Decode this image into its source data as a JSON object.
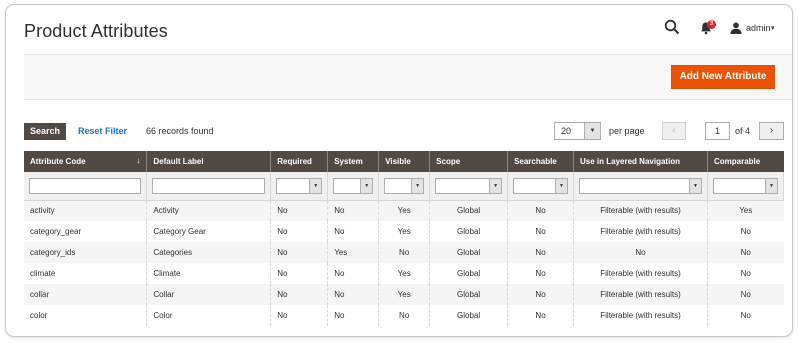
{
  "page": {
    "title": "Product Attributes"
  },
  "header": {
    "notification_count": "3",
    "user_name": "admin",
    "caret": "▾"
  },
  "actions": {
    "add_new_label": "Add New Attribute"
  },
  "toolbar": {
    "search_label": "Search",
    "reset_filter_label": "Reset Filter",
    "records_found": "66 records found",
    "per_page_value": "20",
    "per_page_label": "per page",
    "current_page": "1",
    "page_of": "of 4",
    "prev_symbol": "‹",
    "next_symbol": "›"
  },
  "table": {
    "columns": [
      "Attribute Code",
      "Default Label",
      "Required",
      "System",
      "Visible",
      "Scope",
      "Searchable",
      "Use in Layered Navigation",
      "Comparable"
    ],
    "sort_indicator": "↓",
    "rows": [
      [
        "activity",
        "Activity",
        "No",
        "No",
        "Yes",
        "Global",
        "No",
        "Filterable (with results)",
        "Yes"
      ],
      [
        "category_gear",
        "Category Gear",
        "No",
        "No",
        "Yes",
        "Global",
        "No",
        "Filterable (with results)",
        "No"
      ],
      [
        "category_ids",
        "Categories",
        "No",
        "Yes",
        "No",
        "Global",
        "No",
        "No",
        "No"
      ],
      [
        "climate",
        "Climate",
        "No",
        "No",
        "Yes",
        "Global",
        "No",
        "Filterable (with results)",
        "No"
      ],
      [
        "collar",
        "Collar",
        "No",
        "No",
        "Yes",
        "Global",
        "No",
        "Filterable (with results)",
        "No"
      ],
      [
        "color",
        "Color",
        "No",
        "No",
        "No",
        "Global",
        "No",
        "Filterable (with results)",
        "No"
      ]
    ]
  },
  "colors": {
    "accent": "#eb5202",
    "header_dark": "#514943",
    "link": "#1979c3"
  },
  "icons": [
    "search-icon",
    "bell-icon",
    "user-icon"
  ]
}
